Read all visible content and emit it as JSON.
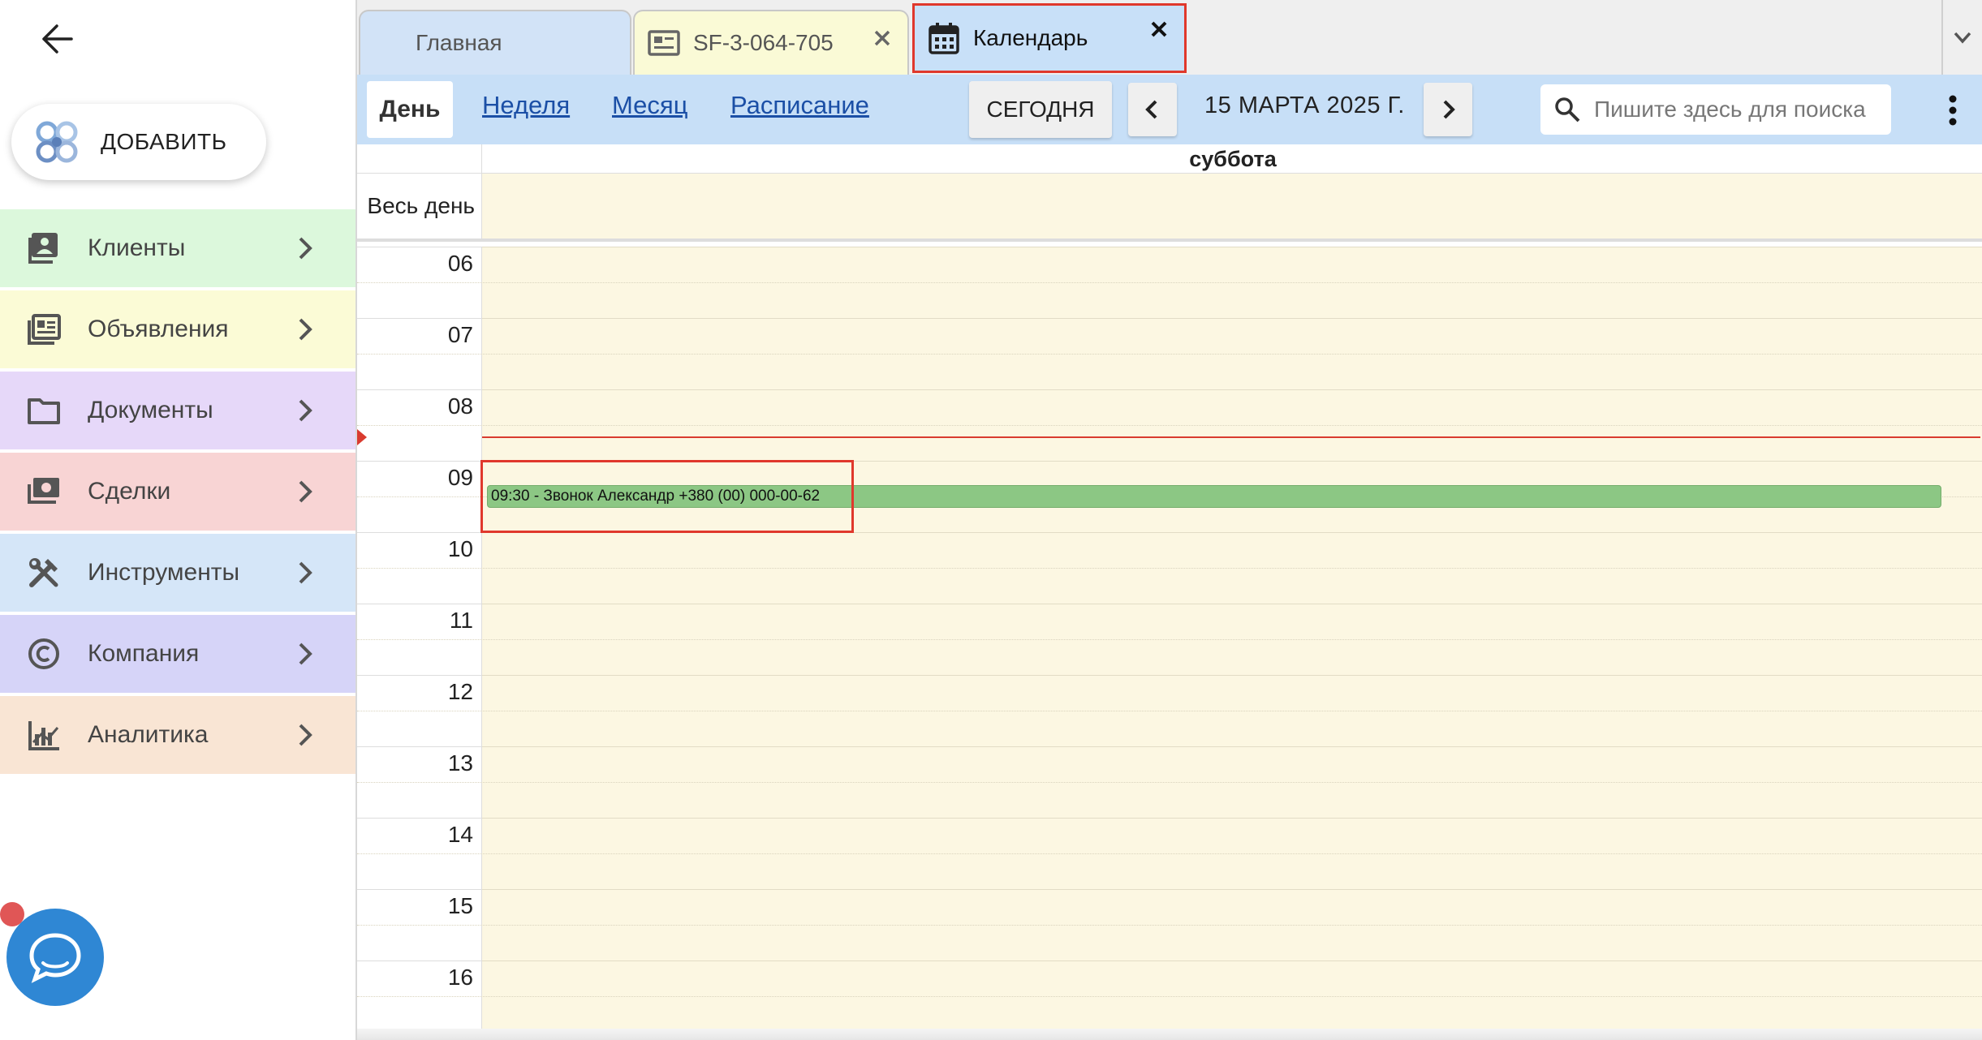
{
  "sidebar": {
    "add_label": "ДОБАВИТЬ",
    "items": [
      {
        "label": "Клиенты",
        "icon": "clients-icon",
        "bg": "#dcf8dc"
      },
      {
        "label": "Объявления",
        "icon": "listings-icon",
        "bg": "#fbfbd6"
      },
      {
        "label": "Документы",
        "icon": "folder-icon",
        "bg": "#e6d8f9"
      },
      {
        "label": "Сделки",
        "icon": "money-icon",
        "bg": "#f8d4d4"
      },
      {
        "label": "Инструменты",
        "icon": "tools-icon",
        "bg": "#d5e6f8"
      },
      {
        "label": "Компания",
        "icon": "copyright-icon",
        "bg": "#d6d4f8"
      },
      {
        "label": "Аналитика",
        "icon": "analytics-icon",
        "bg": "#f9e5d4"
      }
    ]
  },
  "tabs": [
    {
      "label": "Главная"
    },
    {
      "label": "SF-3-064-705"
    },
    {
      "label": "Календарь"
    }
  ],
  "toolbar": {
    "views": [
      "День",
      "Неделя",
      "Месяц",
      "Расписание"
    ],
    "today_label": "СЕГОДНЯ",
    "date_label": "15 МАРТА 2025 Г.",
    "search_placeholder": "Пишите здесь для поиска"
  },
  "calendar": {
    "day_name": "суббота",
    "all_day_label": "Весь день",
    "hours": [
      "06",
      "07",
      "08",
      "09",
      "10",
      "11",
      "12",
      "13",
      "14",
      "15",
      "16"
    ],
    "now_time": "08:40",
    "event": {
      "start": "09:30",
      "text": "09:30 - Звонок Александр +380 (00) 000-00-62",
      "color": "#8cc784"
    }
  },
  "colors": {
    "accent_red": "#e0382c",
    "toolbar_bg": "#c7dff7",
    "calendar_bg": "#fcf7e2",
    "chat_blue": "#2f87d4"
  }
}
